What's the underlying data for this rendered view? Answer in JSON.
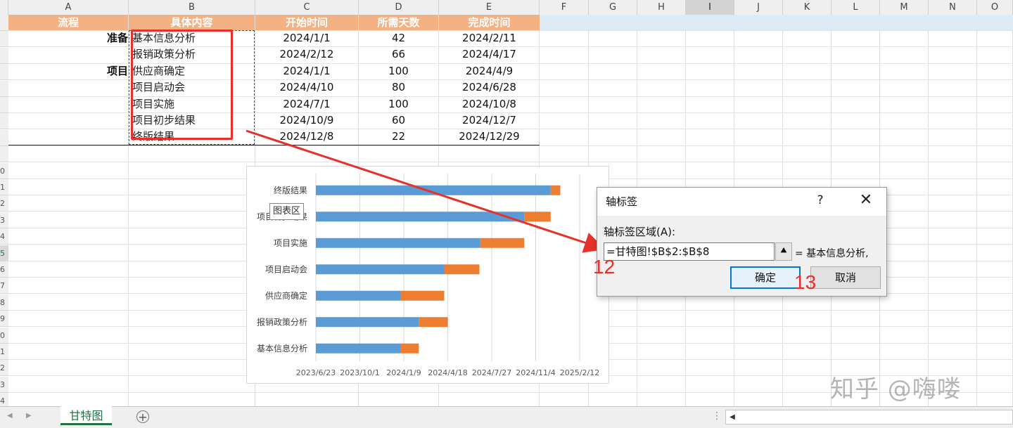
{
  "columns": [
    "A",
    "B",
    "C",
    "D",
    "E",
    "F",
    "G",
    "H",
    "I",
    "J",
    "K",
    "L",
    "M",
    "N",
    "O"
  ],
  "selected_column": "I",
  "row_numbers": [
    "",
    "",
    "",
    "",
    "",
    "",
    "",
    "",
    "",
    "0",
    "1",
    "2",
    "3",
    "4",
    "5",
    "6",
    "7",
    "8",
    "9",
    "0",
    "1",
    "2",
    "3",
    "4"
  ],
  "selected_row_label": "5",
  "table": {
    "headers": [
      "流程",
      "具体内容",
      "开始时间",
      "所需天数",
      "完成时间"
    ],
    "rows": [
      {
        "phase": "准备",
        "task": "基本信息分析",
        "start": "2024/1/1",
        "days": "42",
        "end": "2024/2/11"
      },
      {
        "phase": "",
        "task": "报销政策分析",
        "start": "2024/2/12",
        "days": "66",
        "end": "2024/4/17"
      },
      {
        "phase": "项目",
        "task": "供应商确定",
        "start": "2024/1/1",
        "days": "100",
        "end": "2024/4/9"
      },
      {
        "phase": "",
        "task": "项目启动会",
        "start": "2024/4/10",
        "days": "80",
        "end": "2024/6/28"
      },
      {
        "phase": "",
        "task": "项目实施",
        "start": "2024/7/1",
        "days": "100",
        "end": "2024/10/8"
      },
      {
        "phase": "",
        "task": "项目初步结果",
        "start": "2024/10/9",
        "days": "60",
        "end": "2024/12/7"
      },
      {
        "phase": "",
        "task": "终版结果",
        "start": "2024/12/8",
        "days": "22",
        "end": "2024/12/29"
      }
    ]
  },
  "chart": {
    "tooltip": "图表区",
    "categories": [
      "终版结果",
      "项目初步结果",
      "项目实施",
      "项目启动会",
      "供应商确定",
      "报销政策分析",
      "基本信息分析"
    ],
    "x_ticks": [
      "2023/6/23",
      "2023/10/1",
      "2024/1/9",
      "2024/4/18",
      "2024/7/27",
      "2024/11/4",
      "2025/2/12"
    ],
    "colors": {
      "start": "#5b9bd5",
      "duration": "#ed7d31"
    }
  },
  "chart_data": {
    "type": "bar",
    "orientation": "horizontal",
    "stacked": true,
    "categories": [
      "终版结果",
      "项目初步结果",
      "项目实施",
      "项目启动会",
      "供应商确定",
      "报销政策分析",
      "基本信息分析"
    ],
    "series": [
      {
        "values": [
          "2024/12/8",
          "2024/10/9",
          "2024/7/1",
          "2024/4/10",
          "2024/1/1",
          "2024/2/12",
          "2024/1/1"
        ]
      },
      {
        "values": [
          22,
          60,
          100,
          80,
          100,
          66,
          42
        ]
      }
    ],
    "xlim": [
      "2023/6/23",
      "2025/2/12"
    ],
    "x_ticks": [
      "2023/6/23",
      "2023/10/1",
      "2024/1/9",
      "2024/4/18",
      "2024/7/27",
      "2024/11/4",
      "2025/2/12"
    ],
    "grid": true
  },
  "dialog": {
    "title": "轴标签",
    "help": "?",
    "close": "✕",
    "label": "轴标签区域(A):",
    "input_value": "=甘特图!$B$2:$B$8",
    "collapse": "⯅",
    "preview": "= 基本信息分析,",
    "ok": "确定",
    "cancel": "取消"
  },
  "annotations": {
    "step12": "12",
    "step13": "13"
  },
  "sheet_tab": "甘特图",
  "add_sheet": "+",
  "watermark": "知乎 @嗨喽",
  "colors": {
    "header_fill": "#f4b183",
    "accent": "#217346",
    "annotation": "#e8302a",
    "selection": "#ddebf7"
  }
}
